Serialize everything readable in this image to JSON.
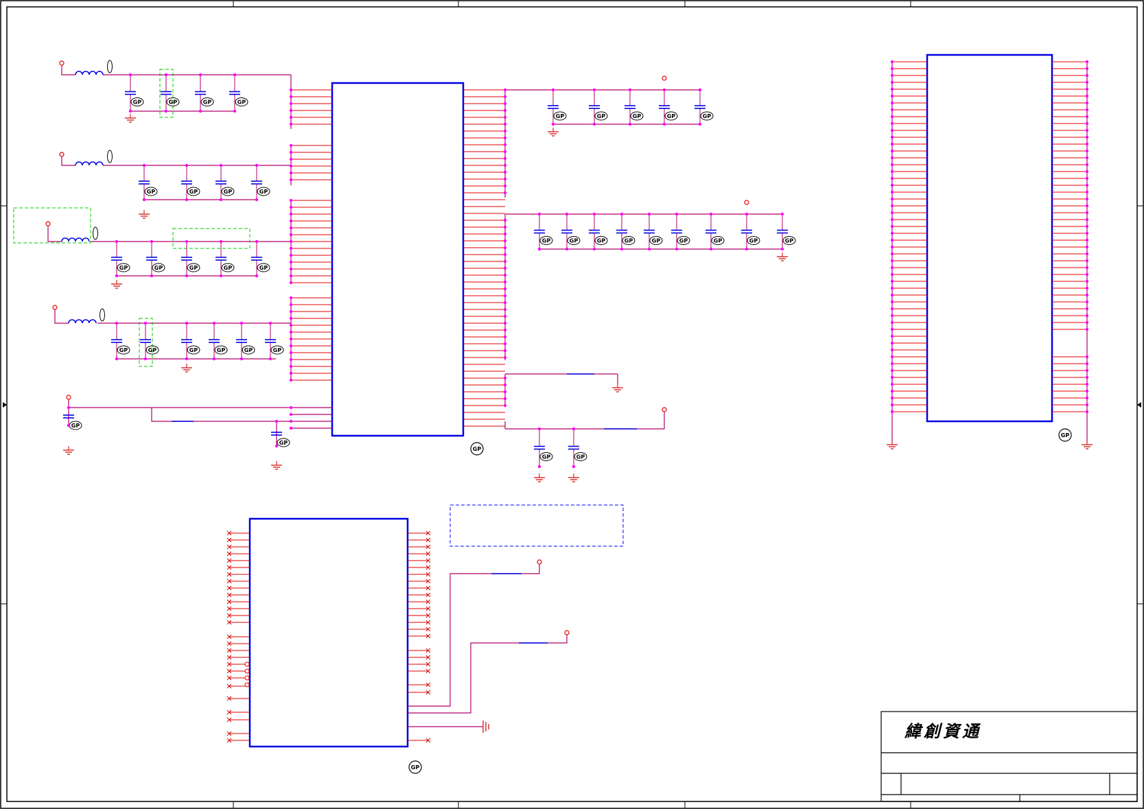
{
  "sheet": {
    "company_name": "緯創資通",
    "gp_marker": "GP",
    "cap_marker": "GP"
  },
  "colors": {
    "wire": "#b0006a",
    "pin": "#e00000",
    "ic": "#0000e0",
    "dot": "#ff00ff",
    "ground": "#d00000",
    "inductor": "#0000e0",
    "net_box": "#00cc00",
    "note_box": "#0000ff",
    "frame": "#000000"
  },
  "components": {
    "power_ic_main": {
      "type": "ic-block"
    },
    "power_ic_bottom": {
      "type": "ic-block"
    },
    "connector_right": {
      "type": "ic-block"
    }
  }
}
